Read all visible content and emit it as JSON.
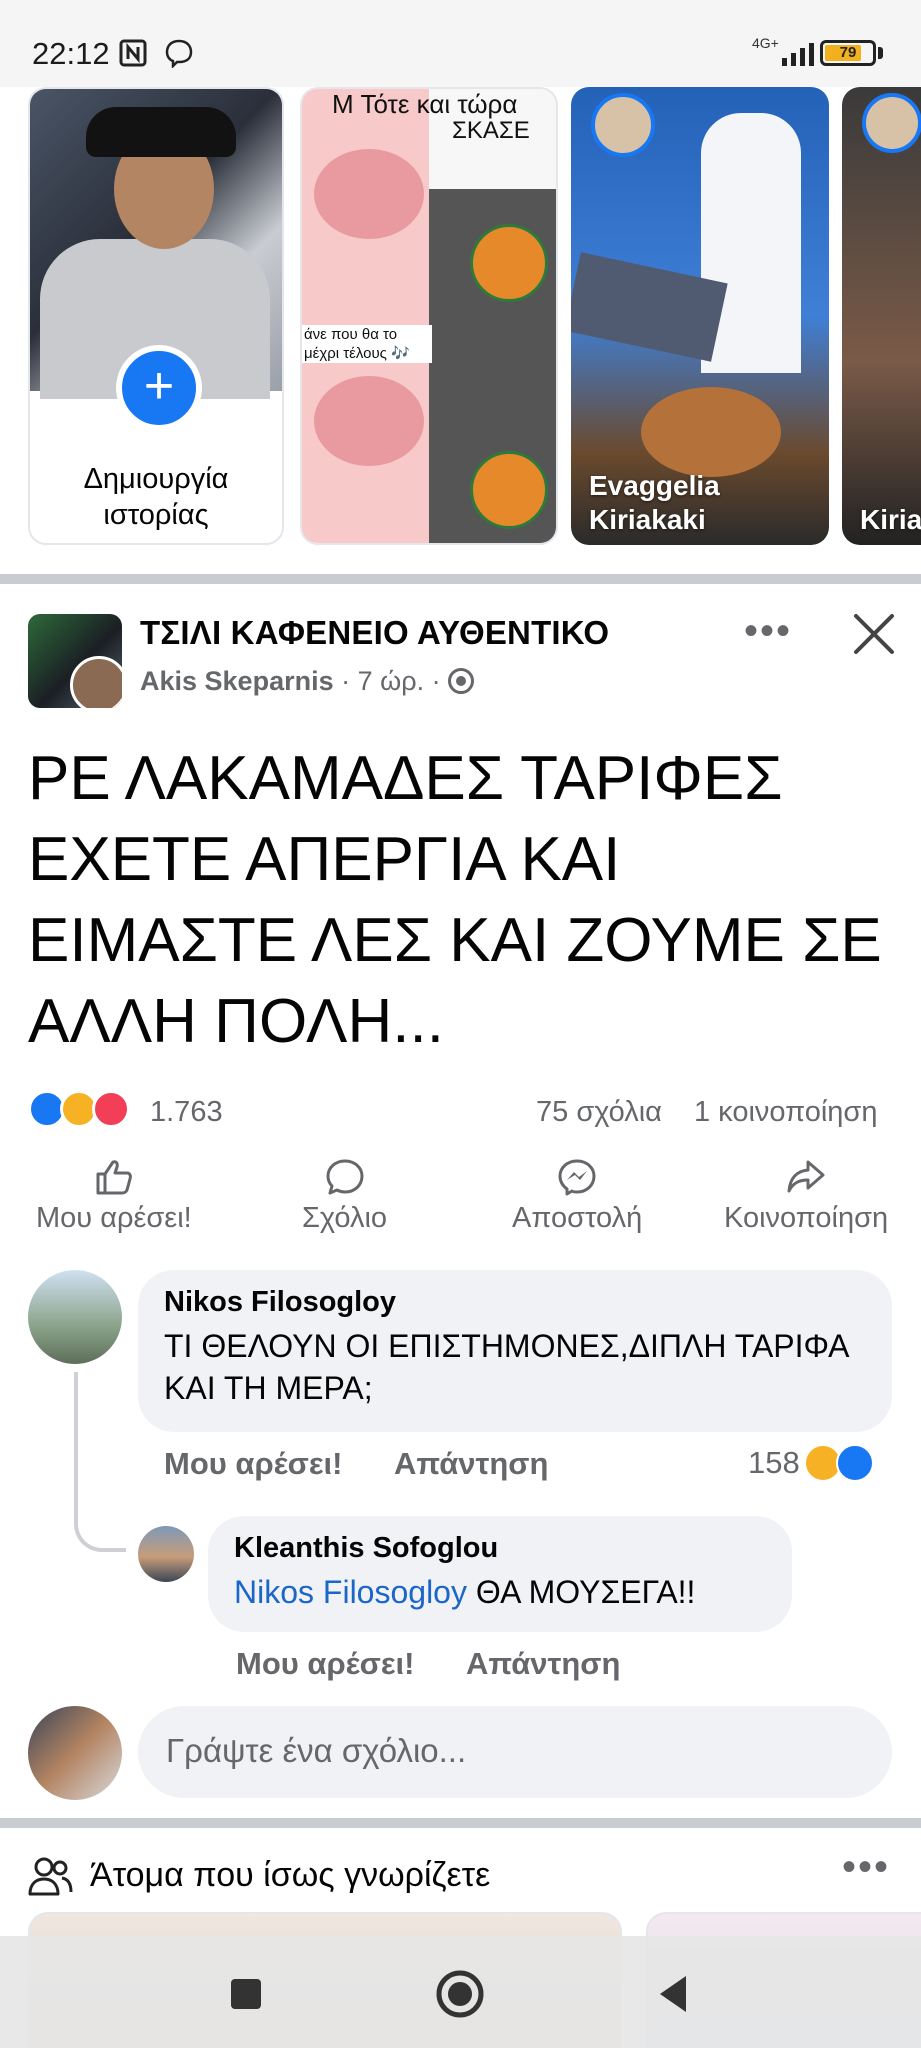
{
  "status_bar": {
    "time": "22:12",
    "network": "4G+",
    "battery": "79",
    "battery_level": 0.79,
    "icons": [
      "nfc-icon",
      "viber-icon",
      "signal-icon",
      "battery-icon"
    ]
  },
  "stories": {
    "create": {
      "label": "Δημιουργία ιστορίας",
      "icon": "plus-icon"
    },
    "items": [
      {
        "text_top": "Τότε και τώρα",
        "text_mid": "ΣΚΑΣΕ",
        "caption": "άνε που θα το μέχρι τέλους 🎶",
        "name": "",
        "top_letter": "Μ"
      },
      {
        "name": "Evaggelia Kiriakaki"
      },
      {
        "name": "Kiria"
      }
    ]
  },
  "post": {
    "group": "ΤΣΙΛΙ ΚΑΦΕΝΕΙΟ ΑΥΘΕΝΤΙΚΟ",
    "author": "Akis Skeparnis",
    "time": "· 7 ώρ. ·",
    "text": "ΡΕ ΛΑΚΑΜΑΔΕΣ ΤΑΡΙΦΕΣ ΕΧΕΤΕ ΑΠΕΡΓΙΑ ΚΑΙ ΕΙΜΑΣΤΕ ΛΕΣ ΚΑΙ ΖΟΥΜΕ ΣΕ ΑΛΛΗ ΠΟΛΗ...",
    "more": "•••",
    "reaction_count": "1.763",
    "comment_count": "75 σχόλια",
    "share_count": "1 κοινοποίηση",
    "actions": {
      "like": "Μου αρέσει!",
      "comment": "Σχόλιο",
      "send": "Αποστολή",
      "share": "Κοινοποίηση"
    }
  },
  "comments": [
    {
      "name": "Nikos Filosogloy",
      "text": "ΤΙ ΘΕΛΟΥΝ ΟΙ ΕΠΙΣΤΗΜΟΝΕΣ,ΔΙΠΛΗ ΤΑΡΙΦΑ ΚΑΙ ΤΗ ΜΕΡΑ;",
      "like": "Μου αρέσει!",
      "reply": "Απάντηση",
      "reactions": "158"
    },
    {
      "name": "Kleanthis Sofoglou",
      "mention": "Nikos Filosogloy",
      "text": " ΘΑ ΜΟΥΣΕΓΑ!!",
      "like": "Μου αρέσει!",
      "reply": "Απάντηση"
    }
  ],
  "write_comment": {
    "placeholder": "Γράψτε ένα σχόλιο..."
  },
  "pymk": {
    "title": "Άτομα που ίσως γνωρίζετε",
    "more": "•••"
  },
  "colors": {
    "accent": "#1877f2",
    "muted_text": "#65676b",
    "bubble": "#f0f2f5",
    "mention": "#1a66c9"
  }
}
